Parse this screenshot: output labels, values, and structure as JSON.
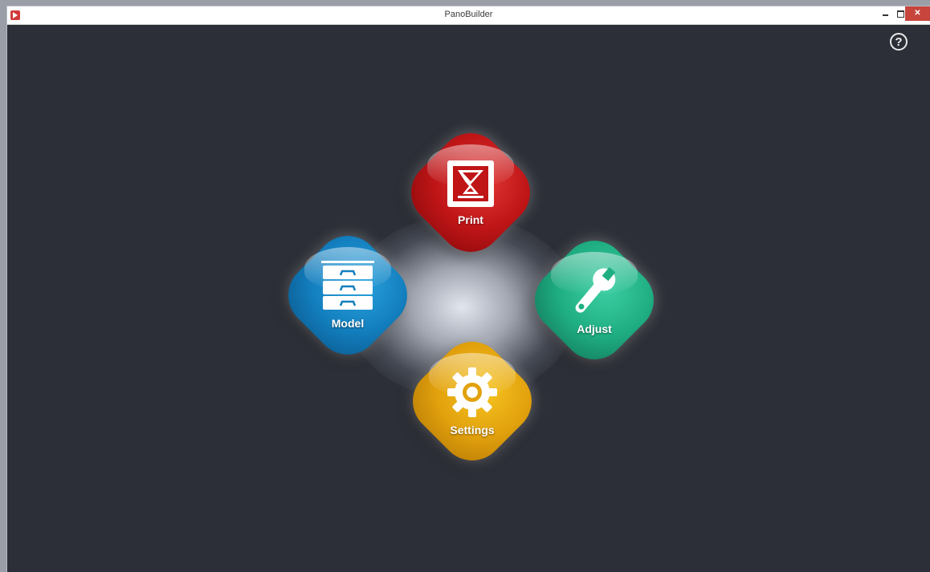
{
  "window": {
    "title": "PanoBuilder",
    "controls": {
      "minimize_icon": "minimize-icon",
      "maximize_icon": "maximize-icon",
      "close_icon": "close-icon"
    }
  },
  "help": {
    "icon": "help-icon",
    "glyph": "?"
  },
  "menu": {
    "print": {
      "label": "Print",
      "icon": "print-icon",
      "color": "#c01517"
    },
    "model": {
      "label": "Model",
      "icon": "drawers-icon",
      "color": "#137fbf"
    },
    "adjust": {
      "label": "Adjust",
      "icon": "wrench-icon",
      "color": "#1fae82"
    },
    "settings": {
      "label": "Settings",
      "icon": "gear-icon",
      "color": "#e2a10d"
    }
  }
}
